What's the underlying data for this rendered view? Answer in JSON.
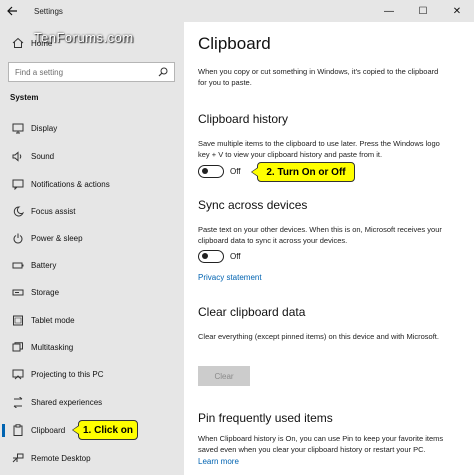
{
  "window": {
    "title": "Settings",
    "back_icon": "back-arrow-icon",
    "minimize_glyph": "—",
    "maximize_glyph": "☐",
    "close_glyph": "✕"
  },
  "watermark": "TenForums.com",
  "sidebar": {
    "home_label": "Home",
    "search_placeholder": "Find a setting",
    "section_label": "System",
    "items": [
      {
        "label": "Display",
        "icon": "display-icon"
      },
      {
        "label": "Sound",
        "icon": "sound-icon"
      },
      {
        "label": "Notifications & actions",
        "icon": "notifications-icon"
      },
      {
        "label": "Focus assist",
        "icon": "focus-assist-icon"
      },
      {
        "label": "Power & sleep",
        "icon": "power-icon"
      },
      {
        "label": "Battery",
        "icon": "battery-icon"
      },
      {
        "label": "Storage",
        "icon": "storage-icon"
      },
      {
        "label": "Tablet mode",
        "icon": "tablet-icon"
      },
      {
        "label": "Multitasking",
        "icon": "multitasking-icon"
      },
      {
        "label": "Projecting to this PC",
        "icon": "projecting-icon"
      },
      {
        "label": "Shared experiences",
        "icon": "shared-experiences-icon"
      },
      {
        "label": "Clipboard",
        "icon": "clipboard-icon",
        "selected": true
      },
      {
        "label": "Remote Desktop",
        "icon": "remote-desktop-icon"
      }
    ]
  },
  "main": {
    "title": "Clipboard",
    "intro": "When you copy or cut something in Windows, it's copied to the clipboard for you to paste.",
    "history": {
      "title": "Clipboard history",
      "description": "Save multiple items to the clipboard to use later. Press the Windows logo key + V to view your clipboard history and paste from it.",
      "toggle_state": "Off"
    },
    "sync": {
      "title": "Sync across devices",
      "description": "Paste text on your other devices. When this is on, Microsoft receives your clipboard data to sync it across your devices.",
      "toggle_state": "Off",
      "privacy_link": "Privacy statement"
    },
    "clear": {
      "title": "Clear clipboard data",
      "description": "Clear everything (except pinned items) on this device and with Microsoft.",
      "button_label": "Clear"
    },
    "pin": {
      "title": "Pin frequently used items",
      "description": "When Clipboard history is On, you can use Pin to keep your favorite items saved even when you clear your clipboard history or restart your PC.",
      "learn_more": "Learn more"
    }
  },
  "callouts": {
    "step1": "1. Click on",
    "step2": "2. Turn On or Off"
  },
  "colors": {
    "accent": "#0063b1",
    "callout_bg": "#ffff00",
    "sidebar_bg": "#e6e6e6"
  }
}
